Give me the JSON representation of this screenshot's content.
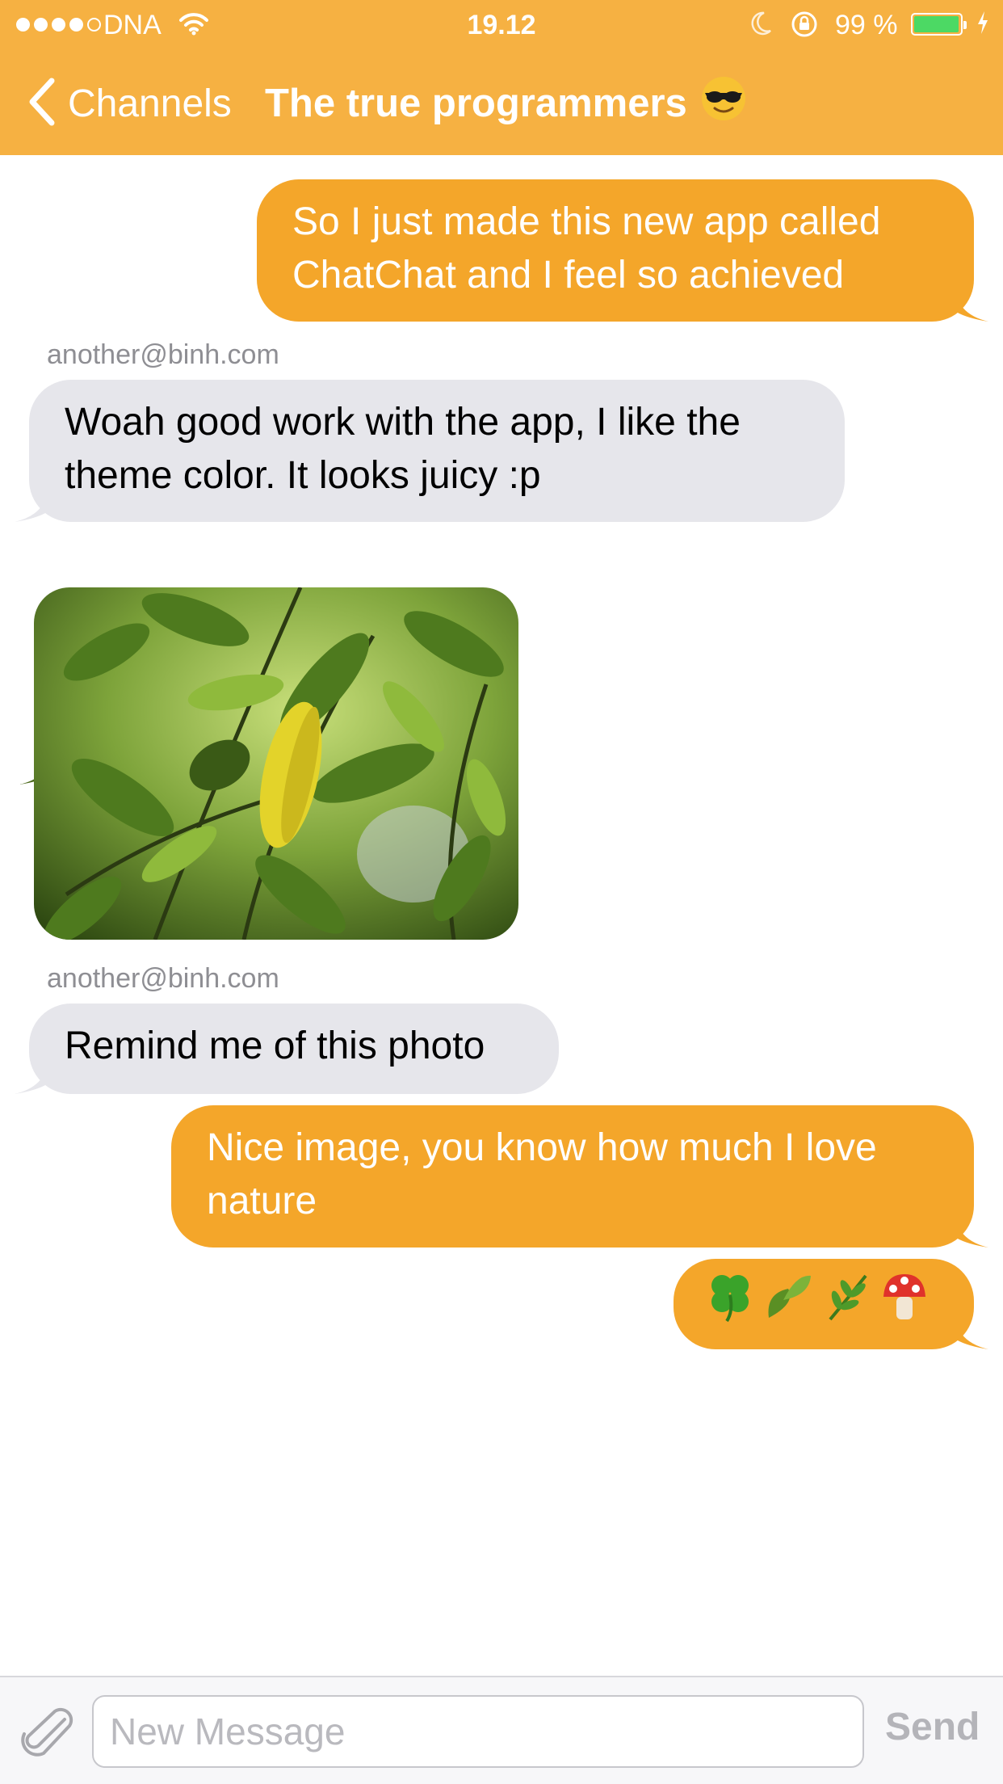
{
  "status_bar": {
    "carrier": "DNA",
    "time": "19.12",
    "battery_percent": "99 %",
    "battery_level": 0.99,
    "signal_bars_filled": 4,
    "signal_bars_total": 5
  },
  "nav": {
    "back_label": "Channels",
    "title": "The true programmers",
    "title_emoji": "😎"
  },
  "messages": [
    {
      "direction": "outgoing",
      "lines": [
        "So I just made this new app called",
        "ChatChat and I feel so achieved"
      ]
    },
    {
      "direction": "incoming",
      "sender": "another@binh.com",
      "lines": [
        "Woah good work with the app, I like the",
        "theme color. It looks juicy :p"
      ]
    },
    {
      "direction": "incoming",
      "type": "photo",
      "description_icon": "leaves-photo"
    },
    {
      "direction": "incoming",
      "sender": "another@binh.com",
      "lines": [
        "Remind me of this photo"
      ]
    },
    {
      "direction": "outgoing",
      "lines": [
        "Nice image, you know how much I love",
        "nature"
      ]
    },
    {
      "direction": "outgoing",
      "text": "🍀🍃🌿🍄"
    }
  ],
  "input": {
    "placeholder": "New Message",
    "value": "",
    "send_label": "Send"
  },
  "colors": {
    "theme": "#f6b142",
    "outgoing_bubble": "#f4a62a",
    "incoming_bubble": "#e6e6eb",
    "sender_text": "#8e8e93"
  }
}
